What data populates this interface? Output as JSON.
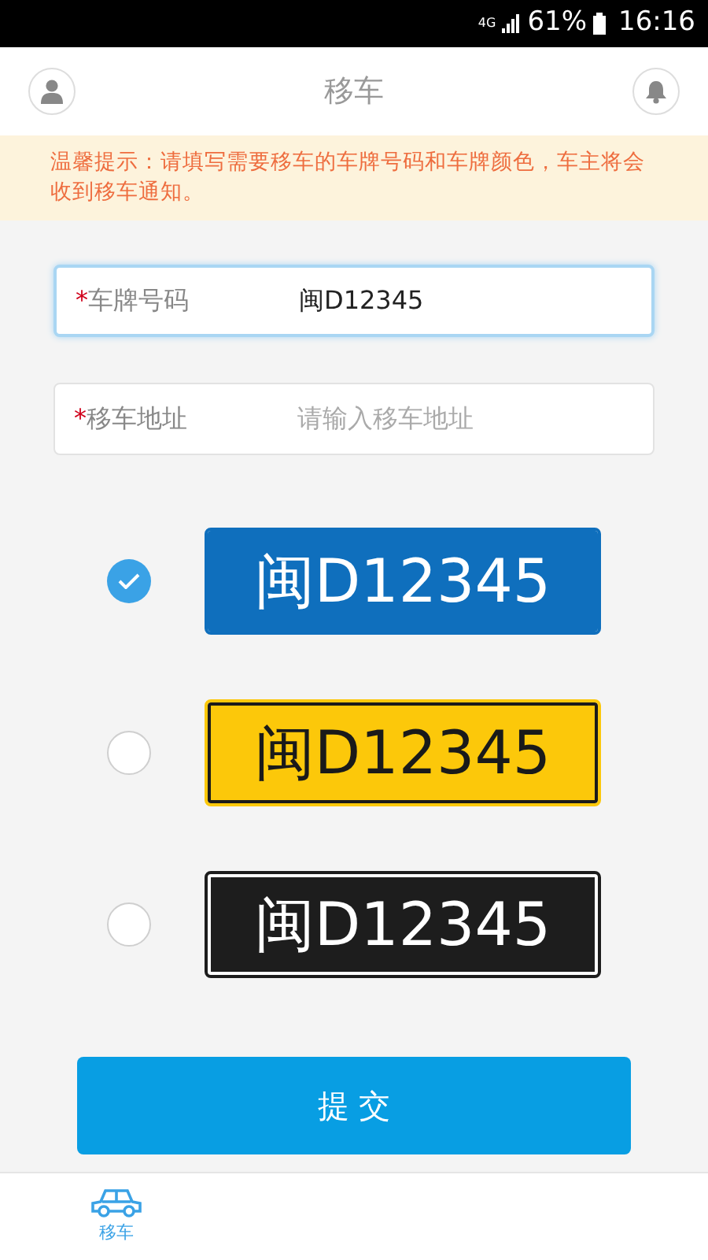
{
  "status_bar": {
    "network": "4G",
    "battery": "61%",
    "time": "16:16"
  },
  "header": {
    "title": "移车"
  },
  "notice": "温馨提示：请填写需要移车的车牌号码和车牌颜色，车主将会收到移车通知。",
  "fields": [
    {
      "required_mark": "*",
      "label": "车牌号码",
      "value": "闽D12345",
      "focused": true
    },
    {
      "required_mark": "*",
      "label": "移车地址",
      "placeholder": "请输入移车地址",
      "focused": false
    }
  ],
  "plates": [
    {
      "kind": "blue",
      "text": "闽D12345",
      "selected": true
    },
    {
      "kind": "yellow",
      "text": "闽D12345",
      "selected": false
    },
    {
      "kind": "black",
      "text": "闽D12345",
      "selected": false
    }
  ],
  "submit_button": "提 交",
  "tab_bar": [
    {
      "label": "移车",
      "selected": true
    }
  ]
}
